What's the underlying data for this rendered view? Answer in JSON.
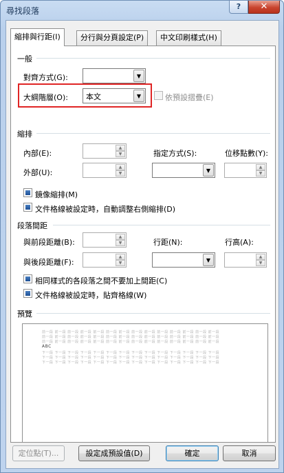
{
  "window": {
    "title": "尋找段落"
  },
  "titlebar": {
    "help_label": "?",
    "close_label": "✕"
  },
  "tabs": [
    {
      "label": "縮排與行距(I)",
      "active": true
    },
    {
      "label": "分行與分頁設定(P)",
      "active": false
    },
    {
      "label": "中文印刷樣式(H)",
      "active": false
    }
  ],
  "general": {
    "heading": "一般",
    "alignment_label": "對齊方式(G):",
    "alignment_value": "",
    "outline_label": "大綱階層(O):",
    "outline_value": "本文",
    "collapsed_label": "依預設摺疊(E)"
  },
  "indent": {
    "heading": "縮排",
    "inner_label": "內部(E):",
    "outer_label": "外部(U):",
    "special_label": "指定方式(S):",
    "by_label": "位移點數(Y):",
    "mirror_label": "鏡像縮排(M)",
    "auto_adjust_label": "文件格線被設定時，自動調整右側縮排(D)"
  },
  "spacing": {
    "heading": "段落間距",
    "before_label": "與前段距離(B):",
    "after_label": "與後段距離(F):",
    "line_spacing_label": "行距(N):",
    "at_label": "行高(A):",
    "no_space_label": "相同樣式的各段落之間不要加上間距(C)",
    "snap_grid_label": "文件格線被設定時，貼齊格線(W)"
  },
  "preview": {
    "heading": "預覽",
    "prev_text": "前一段 前一段 前一段 前一段 前一段 前一段 前一段 前一段 前一段 前一段 前一段 前一段 前一段 前一段",
    "sample": "ABC",
    "next_text": "下一段 下一段 下一段 下一段 下一段 下一段 下一段 下一段 下一段 下一段 下一段 下一段 下一段 下一段"
  },
  "buttons": {
    "tabs_label": "定位點(T)...",
    "default_label": "設定成預設值(D)",
    "ok_label": "確定",
    "cancel_label": "取消"
  },
  "colors": {
    "highlight": "#e02424",
    "check_accent": "#1d4f94"
  }
}
